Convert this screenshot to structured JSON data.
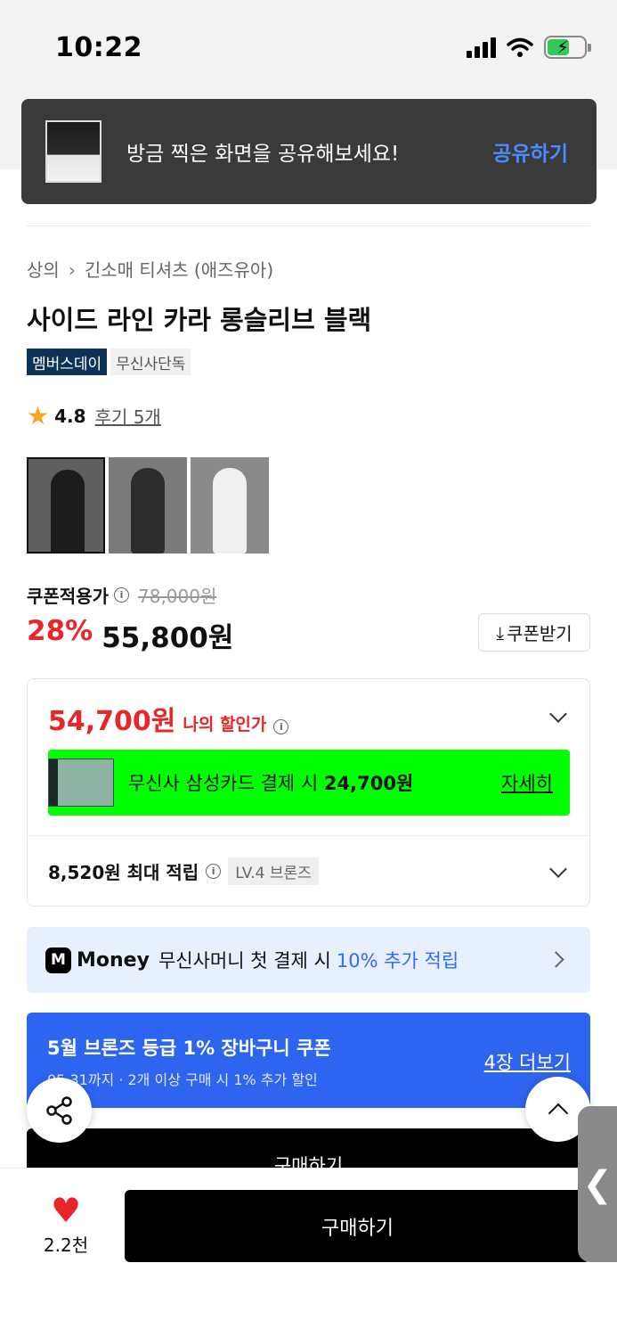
{
  "status": {
    "time": "10:22"
  },
  "toast": {
    "message": "방금 찍은 화면을 공유해보세요!",
    "action": "공유하기"
  },
  "breadcrumb": {
    "category": "상의",
    "subcategory": "긴소매 티셔츠 (애즈유아)"
  },
  "product": {
    "title": "사이드 라인 카라 롱슬리브 블랙",
    "badges": [
      "멤버스데이",
      "무신사단독"
    ],
    "rating": "4.8",
    "reviews": "후기 5개",
    "thumbnails": [
      "black-jacket-front",
      "black-jacket-side",
      "white-jacket"
    ]
  },
  "price": {
    "coupon_label": "쿠폰적용가",
    "original": "78,000원",
    "discount": "28%",
    "final": "55,800원",
    "coupon_button": "쿠폰받기"
  },
  "benefits": {
    "my_price": "54,700원",
    "my_price_label": "나의 할인가",
    "card_text_prefix": "무신사 삼성카드 결제 시",
    "card_amount": "24,700원",
    "card_more": "자세히",
    "points": "8,520원 최대 적립",
    "level": "LV.4 브론즈"
  },
  "money": {
    "brand": "Money",
    "text": "무신사머니 첫 결제 시",
    "highlight": "10% 추가 적립"
  },
  "grade_coupon": {
    "title": "5월 브론즈 등급 1% 장바구니 쿠폰",
    "subtitle": "05.31까지 · 2개 이상 구매 시 1% 추가 할인",
    "more": "4장 더보기"
  },
  "bottom": {
    "likes": "2.2천",
    "buy": "구매하기",
    "ghost_buy": "구매하기"
  },
  "colors": {
    "accent_red": "#e8262a",
    "accent_blue": "#2d64f0",
    "card_green": "#00ff00",
    "member_badge": "#0d3258"
  },
  "icons": [
    "share-icon",
    "chevron-up-icon",
    "heart-icon",
    "star-icon",
    "info-icon",
    "download-icon",
    "chevron-down-icon",
    "chevron-right-icon"
  ]
}
